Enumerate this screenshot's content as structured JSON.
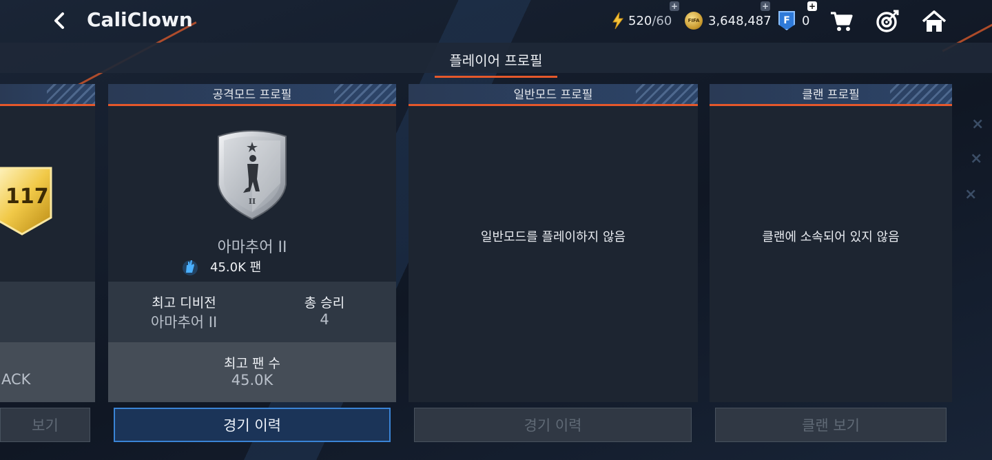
{
  "header": {
    "username": "CaliClown",
    "energy": "520",
    "energy_max": "/60",
    "coins": "3,648,487",
    "fpoints": "0",
    "coin_icon_label": "FIFA"
  },
  "subheader": {
    "title": "플레이어 프로필"
  },
  "partial_card": {
    "rating": "117",
    "label": "ACK",
    "button": "보기"
  },
  "attack_card": {
    "header": "공격모드 프로필",
    "division": "아마추어 II",
    "fans": "45.0K 팬",
    "best_division_label": "최고 디비전",
    "best_division_value": "아마추어 II",
    "total_wins_label": "총 승리",
    "total_wins_value": "4",
    "max_fans_label": "최고 팬 수",
    "max_fans_value": "45.0K",
    "button": "경기 이력"
  },
  "normal_card": {
    "header": "일반모드 프로필",
    "message": "일반모드를 플레이하지 않음",
    "button": "경기 이력"
  },
  "clan_card": {
    "header": "클랜 프로필",
    "message": "클랜에 소속되어 있지 않음",
    "button": "클랜 보기"
  },
  "colors": {
    "accent": "#e5582b",
    "primary_button_border": "#3a84d6",
    "card_bg": "#1d2531"
  }
}
